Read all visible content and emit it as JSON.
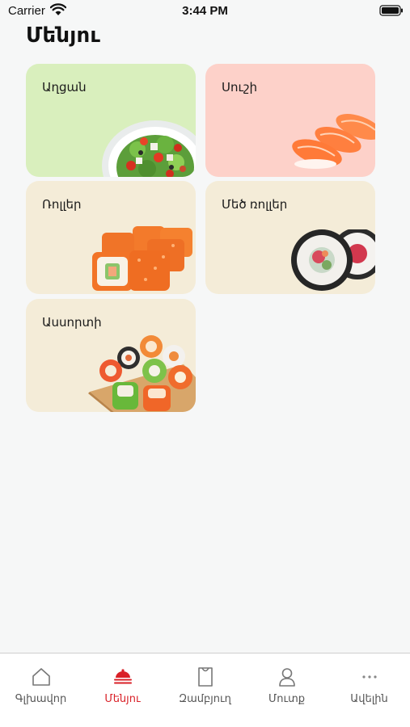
{
  "status_bar": {
    "carrier": "Carrier",
    "time": "3:44 PM"
  },
  "page_title": "Մենյու",
  "categories": [
    {
      "label": "Աղցան"
    },
    {
      "label": "Սուշի"
    },
    {
      "label": "Ռոլլեր"
    },
    {
      "label": "Մեծ ռոլլեր"
    },
    {
      "label": "Ասսորտի"
    }
  ],
  "tab_bar": {
    "tabs": [
      {
        "label": "Գլխավոր",
        "icon": "home-icon"
      },
      {
        "label": "Մենյու",
        "icon": "cloche-icon"
      },
      {
        "label": "Զամբյուղ",
        "icon": "bag-icon"
      },
      {
        "label": "Մուտք",
        "icon": "user-icon"
      },
      {
        "label": "Ավելին",
        "icon": "more-icon"
      }
    ],
    "active_index": 1
  },
  "colors": {
    "accent": "#d92027",
    "salad_card": "#d9efbd",
    "sushi_card": "#fdd1c9",
    "rolls_card": "#f4ecd8",
    "background": "#f6f7f7"
  }
}
